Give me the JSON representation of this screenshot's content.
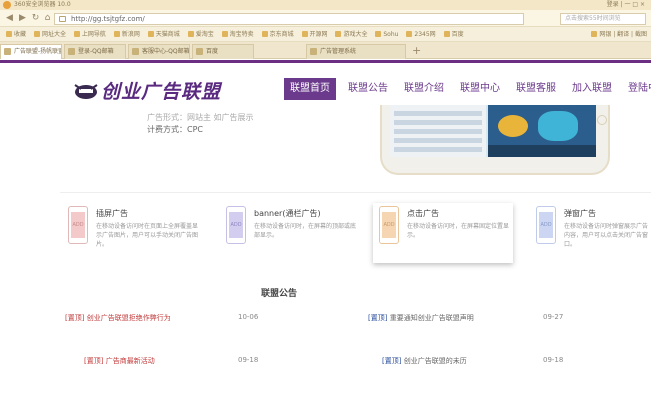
{
  "browser": {
    "title": "360安全浏览器 10.0",
    "window_controls": "登录 | 一 □ ×",
    "url": "http://gg.tsjtgfz.com/",
    "search_placeholder": "点击搜索55时间浏览",
    "bookmarks": [
      "收藏",
      "网址大全",
      "上网导航",
      "新浪网",
      "天猫商城",
      "爱淘宝",
      "淘宝特卖",
      "京东商城",
      "开源网",
      "游戏大全",
      "Sohu",
      "2345网",
      "百度"
    ],
    "bookmarks_right": "网银 | 翻译 | 截图",
    "tabs": [
      "广告联盟-扬帆联盟",
      "登录-QQ邮箱",
      "客服中心-QQ邮箱",
      "百度",
      "广告管理系统"
    ],
    "new_tab": "+"
  },
  "site": {
    "logo_text": "创业广告联盟",
    "menu": [
      "联盟首页",
      "联盟公告",
      "联盟介绍",
      "联盟中心",
      "联盟客服",
      "加入联盟",
      "登陆中"
    ],
    "hero_line1": "广告形式：网站主 如广告展示",
    "hero_line2": "计费方式：CPC",
    "features": [
      {
        "title": "插屏广告",
        "desc": "在移动设备访问时在页面上全屏覆盖显示广告图片，用户可以手动关闭广告图片。",
        "icon_label": "ADD",
        "color": "#f3c9c9"
      },
      {
        "title": "banner(通栏广告)",
        "desc": "在移动设备访问时，在屏幕的顶部或底部显示。",
        "icon_label": "ADD",
        "color": "#d3cdf0"
      },
      {
        "title": "点击广告",
        "desc": "在移动设备访问时，在屏幕固定位置显示。",
        "icon_label": "ADD",
        "color": "#f6d6b2"
      },
      {
        "title": "弹窗广告",
        "desc": "在移动设备访问时弹窗展示广告内容，用户可以点击关闭广告窗口。",
        "icon_label": "ADD",
        "color": "#ccd6f3"
      }
    ],
    "notices_title": "联盟公告",
    "notices": [
      {
        "tag": "[置顶]",
        "text": "创业广告联盟拒绝作弊行为",
        "date": "10-06",
        "red": true
      },
      {
        "tag": "[置顶]",
        "text": "重要通知创业广告联盟声明",
        "date": "09-27",
        "red": false
      },
      {
        "tag": "[置顶]",
        "text": "广告商最新活动",
        "date": "09-18",
        "red": true
      },
      {
        "tag": "[置顶]",
        "text": "创业广告联盟的未历",
        "date": "09-18",
        "red": false
      }
    ]
  }
}
